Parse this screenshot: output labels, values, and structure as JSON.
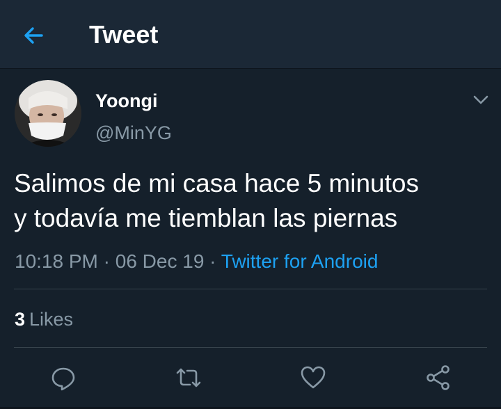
{
  "header": {
    "title": "Tweet",
    "back_icon": "arrow-left-icon"
  },
  "tweet": {
    "author": {
      "name": "Yoongi",
      "handle": "@MinYG"
    },
    "text_line1": "Salimos de mi casa hace 5 minutos",
    "text_line2": "y todavía me tiemblan las piernas",
    "time": "10:18 PM",
    "date": "06 Dec 19",
    "separator": "·",
    "source": "Twitter for Android",
    "likes_count": "3",
    "likes_label": "Likes"
  },
  "actions": [
    "reply-icon",
    "retweet-icon",
    "like-icon",
    "share-icon"
  ],
  "colors": {
    "background": "#15202b",
    "header": "#1b2836",
    "accent": "#1da1f2",
    "secondary_text": "#8899a6",
    "divider": "#38444d"
  }
}
